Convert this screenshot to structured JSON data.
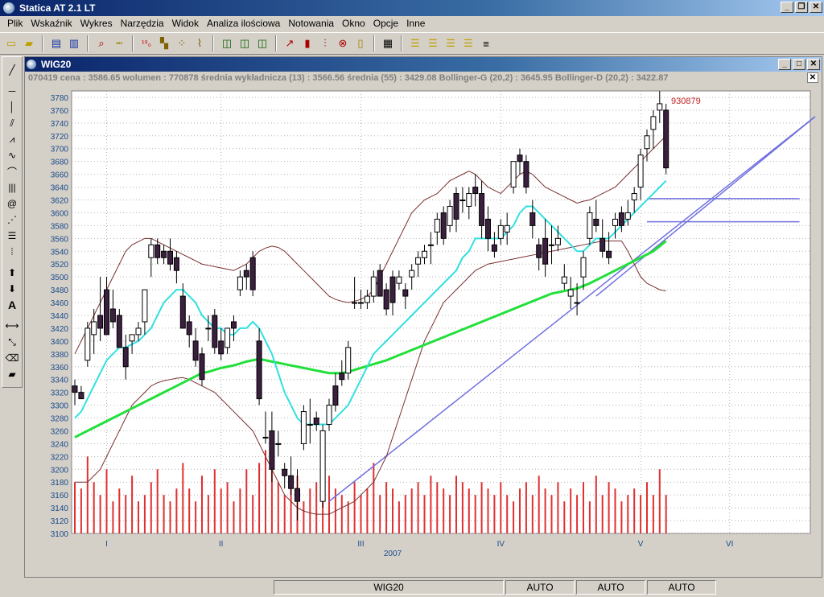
{
  "app": {
    "title": "Statica AT 2.1 LT"
  },
  "menu": [
    "Plik",
    "Wskaźnik",
    "Wykres",
    "Narzędzia",
    "Widok",
    "Analiza ilościowa",
    "Notowania",
    "Okno",
    "Opcje",
    "Inne"
  ],
  "document": {
    "title": "WIG20",
    "info": "070419  cena : 3586.65 wolumen : 770878 średnia wykładnicza (13) : 3566.56 średnia (55) : 3429.08 Bollinger-G (20,2) : 3645.95 Bollinger-D (20,2) : 3422.87"
  },
  "status": {
    "instrument": "WIG20",
    "mode1": "AUTO",
    "mode2": "AUTO",
    "mode3": "AUTO"
  },
  "colors": {
    "candle_down": "#3b1f3f",
    "ema13": "#30e0e0",
    "sma55": "#22e03a",
    "bollinger": "#7a3030",
    "volume": "#e03030",
    "trendline": "#7070e0",
    "grid": "#b0b0b0"
  },
  "chart_data": {
    "type": "candlestick",
    "ylim": [
      3100,
      3790
    ],
    "yticks": [
      3100,
      3120,
      3140,
      3160,
      3180,
      3200,
      3220,
      3240,
      3260,
      3280,
      3300,
      3320,
      3340,
      3360,
      3380,
      3400,
      3420,
      3440,
      3460,
      3480,
      3500,
      3520,
      3540,
      3560,
      3580,
      3600,
      3620,
      3640,
      3660,
      3680,
      3700,
      3720,
      3740,
      3760,
      3780
    ],
    "month_labels": [
      {
        "label": "I",
        "idx": 5
      },
      {
        "label": "II",
        "idx": 23
      },
      {
        "label": "III",
        "idx": 45
      },
      {
        "label": "IV",
        "idx": 67
      },
      {
        "label": "V",
        "idx": 89
      },
      {
        "label": "VI",
        "idx": 103
      }
    ],
    "year_label": {
      "label": "2007",
      "idx": 50
    },
    "annotation": "930879",
    "candles": [
      [
        3330,
        3340,
        3300,
        3320
      ],
      [
        3320,
        3330,
        3310,
        3310
      ],
      [
        3370,
        3430,
        3360,
        3420
      ],
      [
        3410,
        3450,
        3380,
        3430
      ],
      [
        3440,
        3500,
        3400,
        3420
      ],
      [
        3480,
        3500,
        3410,
        3410
      ],
      [
        3450,
        3480,
        3420,
        3430
      ],
      [
        3440,
        3450,
        3390,
        3390
      ],
      [
        3390,
        3410,
        3340,
        3360
      ],
      [
        3400,
        3410,
        3380,
        3410
      ],
      [
        3410,
        3430,
        3400,
        3420
      ],
      [
        3430,
        3480,
        3410,
        3480
      ],
      [
        3530,
        3560,
        3500,
        3550
      ],
      [
        3550,
        3560,
        3520,
        3530
      ],
      [
        3540,
        3550,
        3520,
        3530
      ],
      [
        3540,
        3560,
        3510,
        3520
      ],
      [
        3530,
        3540,
        3490,
        3510
      ],
      [
        3470,
        3490,
        3420,
        3420
      ],
      [
        3430,
        3440,
        3390,
        3410
      ],
      [
        3400,
        3420,
        3360,
        3370
      ],
      [
        3380,
        3390,
        3330,
        3340
      ],
      [
        3420,
        3440,
        3400,
        3420
      ],
      [
        3440,
        3450,
        3380,
        3390
      ],
      [
        3400,
        3420,
        3370,
        3380
      ],
      [
        3390,
        3420,
        3380,
        3420
      ],
      [
        3430,
        3440,
        3400,
        3420
      ],
      [
        3480,
        3510,
        3470,
        3500
      ],
      [
        3510,
        3520,
        3480,
        3500
      ],
      [
        3530,
        3540,
        3470,
        3480
      ],
      [
        3400,
        3420,
        3300,
        3310
      ],
      [
        3250,
        3290,
        3240,
        3250
      ],
      [
        3260,
        3290,
        3180,
        3200
      ],
      [
        3240,
        3260,
        3220,
        3240
      ],
      [
        3200,
        3210,
        3170,
        3190
      ],
      [
        3190,
        3220,
        3160,
        3170
      ],
      [
        3170,
        3200,
        3120,
        3150
      ],
      [
        3240,
        3300,
        3230,
        3290
      ],
      [
        3270,
        3310,
        3240,
        3270
      ],
      [
        3280,
        3290,
        3260,
        3270
      ],
      [
        3150,
        3270,
        3140,
        3260
      ],
      [
        3270,
        3310,
        3260,
        3300
      ],
      [
        3330,
        3350,
        3290,
        3300
      ],
      [
        3350,
        3370,
        3330,
        3340
      ],
      [
        3350,
        3400,
        3340,
        3390
      ],
      [
        3460,
        3500,
        3450,
        3460
      ],
      [
        3460,
        3480,
        3450,
        3460
      ],
      [
        3460,
        3480,
        3450,
        3470
      ],
      [
        3470,
        3510,
        3460,
        3500
      ],
      [
        3510,
        3520,
        3470,
        3470
      ],
      [
        3480,
        3490,
        3440,
        3450
      ],
      [
        3500,
        3510,
        3440,
        3460
      ],
      [
        3490,
        3510,
        3480,
        3500
      ],
      [
        3480,
        3490,
        3450,
        3470
      ],
      [
        3500,
        3520,
        3480,
        3510
      ],
      [
        3520,
        3540,
        3500,
        3530
      ],
      [
        3530,
        3550,
        3520,
        3540
      ],
      [
        3550,
        3570,
        3520,
        3550
      ],
      [
        3570,
        3600,
        3550,
        3590
      ],
      [
        3600,
        3610,
        3550,
        3560
      ],
      [
        3580,
        3620,
        3570,
        3610
      ],
      [
        3630,
        3640,
        3570,
        3590
      ],
      [
        3620,
        3640,
        3600,
        3620
      ],
      [
        3610,
        3640,
        3590,
        3630
      ],
      [
        3640,
        3660,
        3610,
        3630
      ],
      [
        3630,
        3650,
        3560,
        3580
      ],
      [
        3590,
        3610,
        3540,
        3560
      ],
      [
        3550,
        3570,
        3530,
        3540
      ],
      [
        3560,
        3590,
        3550,
        3580
      ],
      [
        3570,
        3600,
        3550,
        3580
      ],
      [
        3640,
        3680,
        3630,
        3680
      ],
      [
        3690,
        3700,
        3660,
        3680
      ],
      [
        3680,
        3690,
        3630,
        3640
      ],
      [
        3600,
        3620,
        3560,
        3580
      ],
      [
        3550,
        3560,
        3510,
        3530
      ],
      [
        3560,
        3590,
        3500,
        3520
      ],
      [
        3550,
        3580,
        3520,
        3550
      ],
      [
        3550,
        3580,
        3540,
        3560
      ],
      [
        3490,
        3520,
        3480,
        3500
      ],
      [
        3470,
        3500,
        3450,
        3480
      ],
      [
        3460,
        3490,
        3440,
        3460
      ],
      [
        3500,
        3540,
        3480,
        3530
      ],
      [
        3560,
        3610,
        3550,
        3600
      ],
      [
        3590,
        3620,
        3570,
        3580
      ],
      [
        3560,
        3590,
        3530,
        3540
      ],
      [
        3540,
        3570,
        3520,
        3530
      ],
      [
        3580,
        3600,
        3560,
        3590
      ],
      [
        3600,
        3610,
        3570,
        3580
      ],
      [
        3590,
        3620,
        3580,
        3600
      ],
      [
        3620,
        3640,
        3600,
        3630
      ],
      [
        3640,
        3700,
        3620,
        3690
      ],
      [
        3700,
        3730,
        3680,
        3720
      ],
      [
        3730,
        3760,
        3700,
        3750
      ],
      [
        3760,
        3790,
        3740,
        3770
      ],
      [
        3760,
        3770,
        3660,
        3670
      ]
    ],
    "volume": [
      3180,
      3170,
      3220,
      3180,
      3160,
      3200,
      3150,
      3170,
      3160,
      3190,
      3150,
      3160,
      3180,
      3200,
      3160,
      3150,
      3170,
      3210,
      3170,
      3150,
      3190,
      3160,
      3200,
      3170,
      3180,
      3150,
      3170,
      3200,
      3160,
      3210,
      3230,
      3200,
      3180,
      3160,
      3170,
      3190,
      3150,
      3170,
      3180,
      3160,
      3190,
      3170,
      3160,
      3150,
      3180,
      3160,
      3170,
      3210,
      3160,
      3180,
      3170,
      3150,
      3160,
      3170,
      3180,
      3160,
      3190,
      3180,
      3170,
      3160,
      3190,
      3180,
      3170,
      3160,
      3180,
      3170,
      3160,
      3180,
      3160,
      3150,
      3170,
      3180,
      3160,
      3190,
      3170,
      3160,
      3180,
      3150,
      3170,
      3160,
      3180,
      3150,
      3190,
      3160,
      3180,
      3170,
      3150,
      3160,
      3170,
      3160,
      3180,
      3160,
      3200,
      3160,
      3180,
      3170
    ],
    "ema13": [
      3280,
      3290,
      3310,
      3330,
      3350,
      3370,
      3380,
      3390,
      3390,
      3395,
      3400,
      3410,
      3420,
      3440,
      3460,
      3470,
      3480,
      3480,
      3470,
      3460,
      3440,
      3430,
      3420,
      3420,
      3410,
      3410,
      3420,
      3420,
      3430,
      3420,
      3400,
      3380,
      3350,
      3320,
      3300,
      3280,
      3270,
      3270,
      3270,
      3270,
      3270,
      3280,
      3290,
      3300,
      3320,
      3340,
      3360,
      3380,
      3390,
      3400,
      3410,
      3420,
      3430,
      3440,
      3450,
      3460,
      3470,
      3480,
      3490,
      3500,
      3510,
      3530,
      3540,
      3560,
      3560,
      3560,
      3560,
      3560,
      3570,
      3580,
      3600,
      3610,
      3610,
      3600,
      3590,
      3580,
      3570,
      3560,
      3550,
      3540,
      3540,
      3550,
      3560,
      3560,
      3560,
      3570,
      3580,
      3590,
      3600,
      3610,
      3620,
      3630,
      3640,
      3650,
      3650
    ],
    "sma55": [
      3250,
      3255,
      3260,
      3265,
      3270,
      3275,
      3280,
      3285,
      3290,
      3295,
      3300,
      3305,
      3310,
      3315,
      3320,
      3325,
      3330,
      3335,
      3340,
      3345,
      3350,
      3352,
      3355,
      3358,
      3360,
      3362,
      3365,
      3368,
      3370,
      3372,
      3370,
      3368,
      3366,
      3364,
      3362,
      3360,
      3358,
      3356,
      3354,
      3352,
      3350,
      3350,
      3350,
      3352,
      3355,
      3358,
      3361,
      3364,
      3367,
      3370,
      3374,
      3378,
      3382,
      3386,
      3390,
      3394,
      3398,
      3402,
      3406,
      3410,
      3414,
      3418,
      3422,
      3426,
      3430,
      3434,
      3438,
      3442,
      3446,
      3450,
      3454,
      3458,
      3462,
      3466,
      3470,
      3474,
      3476,
      3478,
      3480,
      3482,
      3486,
      3490,
      3495,
      3500,
      3505,
      3510,
      3515,
      3520,
      3525,
      3530,
      3535,
      3540,
      3548,
      3556,
      3564
    ],
    "boll_up": [
      3380,
      3400,
      3420,
      3440,
      3460,
      3480,
      3500,
      3520,
      3540,
      3550,
      3555,
      3560,
      3560,
      3555,
      3550,
      3545,
      3540,
      3535,
      3530,
      3525,
      3520,
      3518,
      3516,
      3514,
      3512,
      3510,
      3515,
      3520,
      3530,
      3540,
      3545,
      3548,
      3546,
      3540,
      3530,
      3520,
      3510,
      3500,
      3490,
      3480,
      3470,
      3465,
      3462,
      3460,
      3462,
      3465,
      3470,
      3480,
      3500,
      3520,
      3540,
      3560,
      3580,
      3600,
      3610,
      3620,
      3625,
      3630,
      3640,
      3650,
      3655,
      3660,
      3665,
      3660,
      3650,
      3640,
      3635,
      3630,
      3640,
      3650,
      3660,
      3665,
      3660,
      3650,
      3640,
      3635,
      3630,
      3625,
      3620,
      3615,
      3618,
      3620,
      3625,
      3630,
      3635,
      3640,
      3650,
      3660,
      3670,
      3680,
      3690,
      3700,
      3710,
      3720,
      3730
    ],
    "boll_dn": [
      3180,
      3180,
      3180,
      3190,
      3200,
      3220,
      3240,
      3260,
      3280,
      3300,
      3310,
      3320,
      3330,
      3335,
      3338,
      3340,
      3342,
      3343,
      3340,
      3335,
      3330,
      3325,
      3320,
      3310,
      3300,
      3290,
      3280,
      3270,
      3260,
      3240,
      3220,
      3200,
      3180,
      3160,
      3150,
      3140,
      3135,
      3132,
      3130,
      3130,
      3130,
      3135,
      3140,
      3145,
      3150,
      3160,
      3170,
      3180,
      3200,
      3220,
      3250,
      3280,
      3310,
      3340,
      3370,
      3400,
      3420,
      3440,
      3460,
      3470,
      3480,
      3490,
      3500,
      3510,
      3515,
      3520,
      3522,
      3524,
      3526,
      3528,
      3530,
      3532,
      3534,
      3536,
      3538,
      3540,
      3542,
      3544,
      3546,
      3548,
      3550,
      3552,
      3554,
      3556,
      3556,
      3556,
      3556,
      3540,
      3520,
      3500,
      3490,
      3485,
      3480,
      3478,
      3476
    ]
  }
}
